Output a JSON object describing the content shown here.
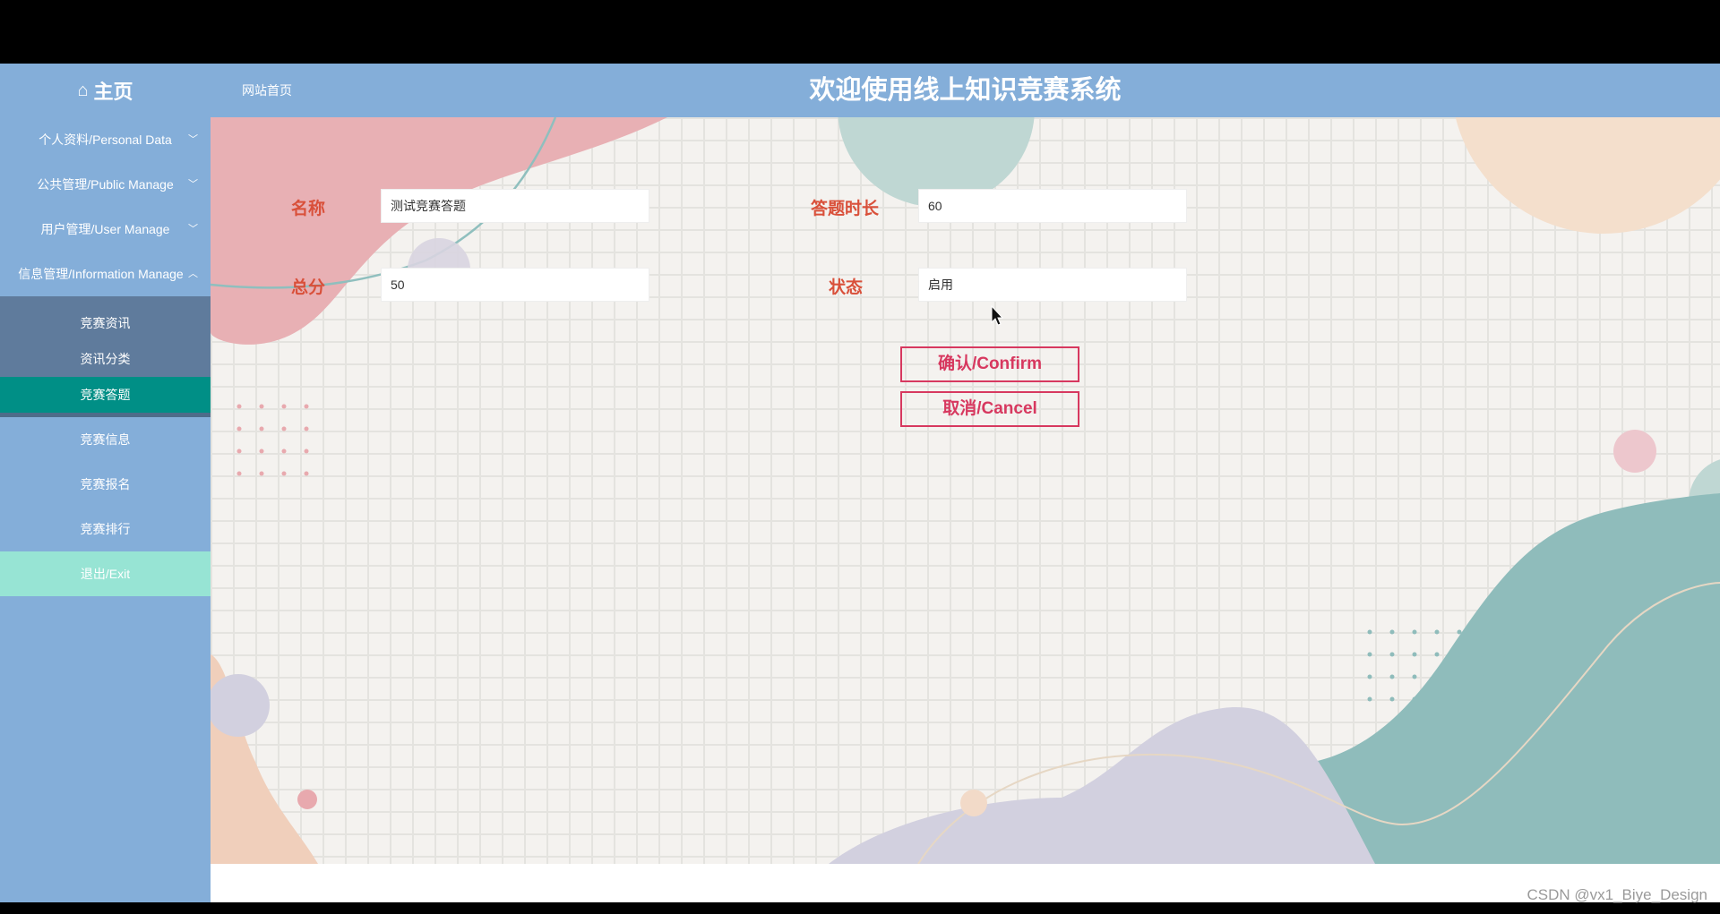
{
  "header": {
    "home_label": "主页",
    "home_icon": "home-icon",
    "site_home_link": "网站首页",
    "system_title": "欢迎使用线上知识竞赛系统"
  },
  "sidebar": {
    "items": [
      {
        "label": "个人资料/Personal Data",
        "expanded": false
      },
      {
        "label": "公共管理/Public Manage",
        "expanded": false
      },
      {
        "label": "用户管理/User Manage",
        "expanded": false
      },
      {
        "label": "信息管理/Information Manage",
        "expanded": true
      }
    ],
    "submenu": [
      "竞赛资讯",
      "资讯分类",
      "竞赛答题"
    ],
    "active_submenu": "竞赛答题",
    "more_items": [
      "竞赛信息",
      "竞赛报名",
      "竞赛排行"
    ],
    "exit_label": "退出/Exit"
  },
  "form": {
    "name_label": "名称",
    "name_value": "测试竞赛答题",
    "duration_label": "答题时长",
    "duration_value": "60",
    "total_label": "总分",
    "total_value": "50",
    "status_label": "状态",
    "status_value": "启用",
    "confirm_label": "确认/Confirm",
    "cancel_label": "取消/Cancel"
  },
  "watermark": "CSDN @vx1_Biye_Design",
  "colors": {
    "primary_blue": "#84aed9",
    "active_teal": "#008f86",
    "label_red": "#d9503a",
    "button_red": "#d7385f",
    "exit_bg": "#97e4d4"
  }
}
